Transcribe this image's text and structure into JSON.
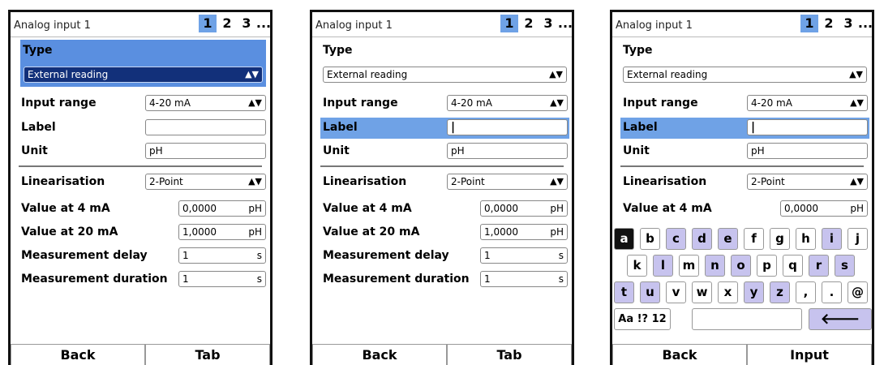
{
  "screens": [
    {
      "title": "Analog input 1",
      "pages": [
        "1",
        "2",
        "3",
        "..."
      ],
      "type_label": "Type",
      "type_value": "External reading",
      "input_range_label": "Input range",
      "input_range_value": "4-20 mA",
      "label_label": "Label",
      "label_value": "",
      "unit_label": "Unit",
      "unit_value": "pH",
      "linearisation_label": "Linearisation",
      "linearisation_value": "2-Point",
      "v4_label": "Value at 4 mA",
      "v4_value": "0,0000",
      "v4_unit": "pH",
      "v20_label": "Value at 20 mA",
      "v20_value": "1,0000",
      "v20_unit": "pH",
      "delay_label": "Measurement delay",
      "delay_value": "1",
      "delay_unit": "s",
      "duration_label": "Measurement duration",
      "duration_value": "1",
      "duration_unit": "s",
      "footer_left": "Back",
      "footer_right": "Tab",
      "highlighted": "type"
    },
    {
      "title": "Analog input 1",
      "pages": [
        "1",
        "2",
        "3",
        "..."
      ],
      "type_label": "Type",
      "type_value": "External reading",
      "input_range_label": "Input range",
      "input_range_value": "4-20 mA",
      "label_label": "Label",
      "label_value": "|",
      "unit_label": "Unit",
      "unit_value": "pH",
      "linearisation_label": "Linearisation",
      "linearisation_value": "2-Point",
      "v4_label": "Value at 4 mA",
      "v4_value": "0,0000",
      "v4_unit": "pH",
      "v20_label": "Value at 20 mA",
      "v20_value": "1,0000",
      "v20_unit": "pH",
      "delay_label": "Measurement delay",
      "delay_value": "1",
      "delay_unit": "s",
      "duration_label": "Measurement duration",
      "duration_value": "1",
      "duration_unit": "s",
      "footer_left": "Back",
      "footer_right": "Tab",
      "highlighted": "label"
    },
    {
      "title": "Analog input 1",
      "pages": [
        "1",
        "2",
        "3",
        "..."
      ],
      "type_label": "Type",
      "type_value": "External reading",
      "input_range_label": "Input range",
      "input_range_value": "4-20 mA",
      "label_label": "Label",
      "label_value": "|",
      "unit_label": "Unit",
      "unit_value": "pH",
      "linearisation_label": "Linearisation",
      "linearisation_value": "2-Point",
      "v4_label": "Value at 4 mA",
      "v4_value": "0,0000",
      "v4_unit": "pH",
      "keyboard": {
        "row1": [
          "a",
          "b",
          "c",
          "d",
          "e",
          "f",
          "g",
          "h",
          "i",
          "j"
        ],
        "row2": [
          "k",
          "l",
          "m",
          "n",
          "o",
          "p",
          "q",
          "r",
          "s"
        ],
        "row3": [
          "t",
          "u",
          "v",
          "w",
          "x",
          "y",
          "z",
          ",",
          ".",
          "@"
        ],
        "mode_key": "Aa !? 12",
        "enter_key": "🡐"
      },
      "footer_left": "Back",
      "footer_right": "Input",
      "highlighted": "label"
    }
  ],
  "colors": {
    "highlight": "#6fa2e6",
    "type_select_bg": "#5a8fe0",
    "type_field_bg": "#12307a",
    "key_lavender": "#c7c3ee"
  },
  "icons": {
    "dropdown": "updown-arrows-icon",
    "enter": "backspace-arrow-icon"
  }
}
